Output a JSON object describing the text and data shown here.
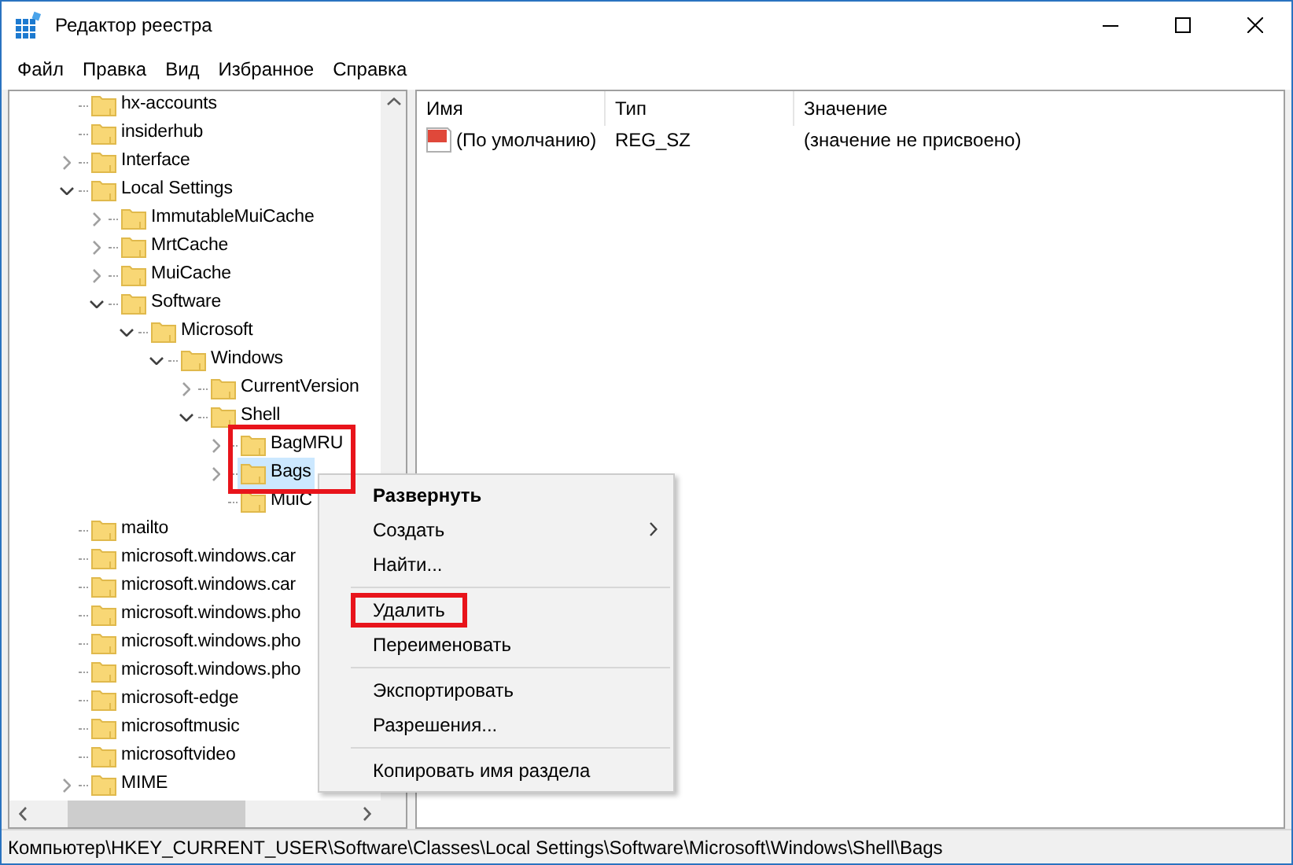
{
  "window": {
    "title": "Редактор реестра"
  },
  "menu_bar": [
    "Файл",
    "Правка",
    "Вид",
    "Избранное",
    "Справка"
  ],
  "tree": [
    {
      "label": "hx-accounts",
      "selected": false
    },
    {
      "label": "insiderhub",
      "selected": false
    },
    {
      "label": "Interface",
      "selected": false,
      "expanded": false
    },
    {
      "label": "Local Settings",
      "selected": false,
      "expanded": true,
      "children": [
        {
          "label": "ImmutableMuiCache",
          "selected": false,
          "expanded": false
        },
        {
          "label": "MrtCache",
          "selected": false,
          "expanded": false
        },
        {
          "label": "MuiCache",
          "selected": false,
          "expanded": false
        },
        {
          "label": "Software",
          "selected": false,
          "expanded": true,
          "children": [
            {
              "label": "Microsoft",
              "selected": false,
              "expanded": true,
              "children": [
                {
                  "label": "Windows",
                  "selected": false,
                  "expanded": true,
                  "children": [
                    {
                      "label": "CurrentVersion",
                      "selected": false,
                      "expanded": false
                    },
                    {
                      "label": "Shell",
                      "selected": false,
                      "expanded": true,
                      "children": [
                        {
                          "label": "BagMRU",
                          "selected": false,
                          "expanded": false,
                          "outlined": true
                        },
                        {
                          "label": "Bags",
                          "selected": true,
                          "expanded": false,
                          "outlined": true
                        },
                        {
                          "label": "MuiC",
                          "selected": false
                        }
                      ]
                    }
                  ]
                }
              ]
            }
          ]
        }
      ]
    },
    {
      "label": "mailto",
      "selected": false
    },
    {
      "label": "microsoft.windows.car",
      "selected": false
    },
    {
      "label": "microsoft.windows.car",
      "selected": false
    },
    {
      "label": "microsoft.windows.pho",
      "selected": false
    },
    {
      "label": "microsoft.windows.pho",
      "selected": false
    },
    {
      "label": "microsoft.windows.pho",
      "selected": false
    },
    {
      "label": "microsoft-edge",
      "selected": false
    },
    {
      "label": "microsoftmusic",
      "selected": false
    },
    {
      "label": "microsoftvideo",
      "selected": false
    },
    {
      "label": "MIME",
      "selected": false,
      "expanded": false
    }
  ],
  "values_table": {
    "columns": [
      "Имя",
      "Тип",
      "Значение"
    ],
    "rows": [
      {
        "name": "(По умолчанию)",
        "type": "REG_SZ",
        "value": "(значение не присвоено)"
      }
    ]
  },
  "context_menu": [
    {
      "kind": "item",
      "label": "Развернуть",
      "default": true
    },
    {
      "kind": "item",
      "label": "Создать",
      "submenu": true
    },
    {
      "kind": "item",
      "label": "Найти..."
    },
    {
      "kind": "separator"
    },
    {
      "kind": "item",
      "label": "Удалить",
      "outlined": true
    },
    {
      "kind": "item",
      "label": "Переименовать"
    },
    {
      "kind": "separator"
    },
    {
      "kind": "item",
      "label": "Экспортировать"
    },
    {
      "kind": "item",
      "label": "Разрешения..."
    },
    {
      "kind": "separator"
    },
    {
      "kind": "item",
      "label": "Копировать имя раздела"
    }
  ],
  "status_bar": "Компьютер\\HKEY_CURRENT_USER\\Software\\Classes\\Local Settings\\Software\\Microsoft\\Windows\\Shell\\Bags"
}
